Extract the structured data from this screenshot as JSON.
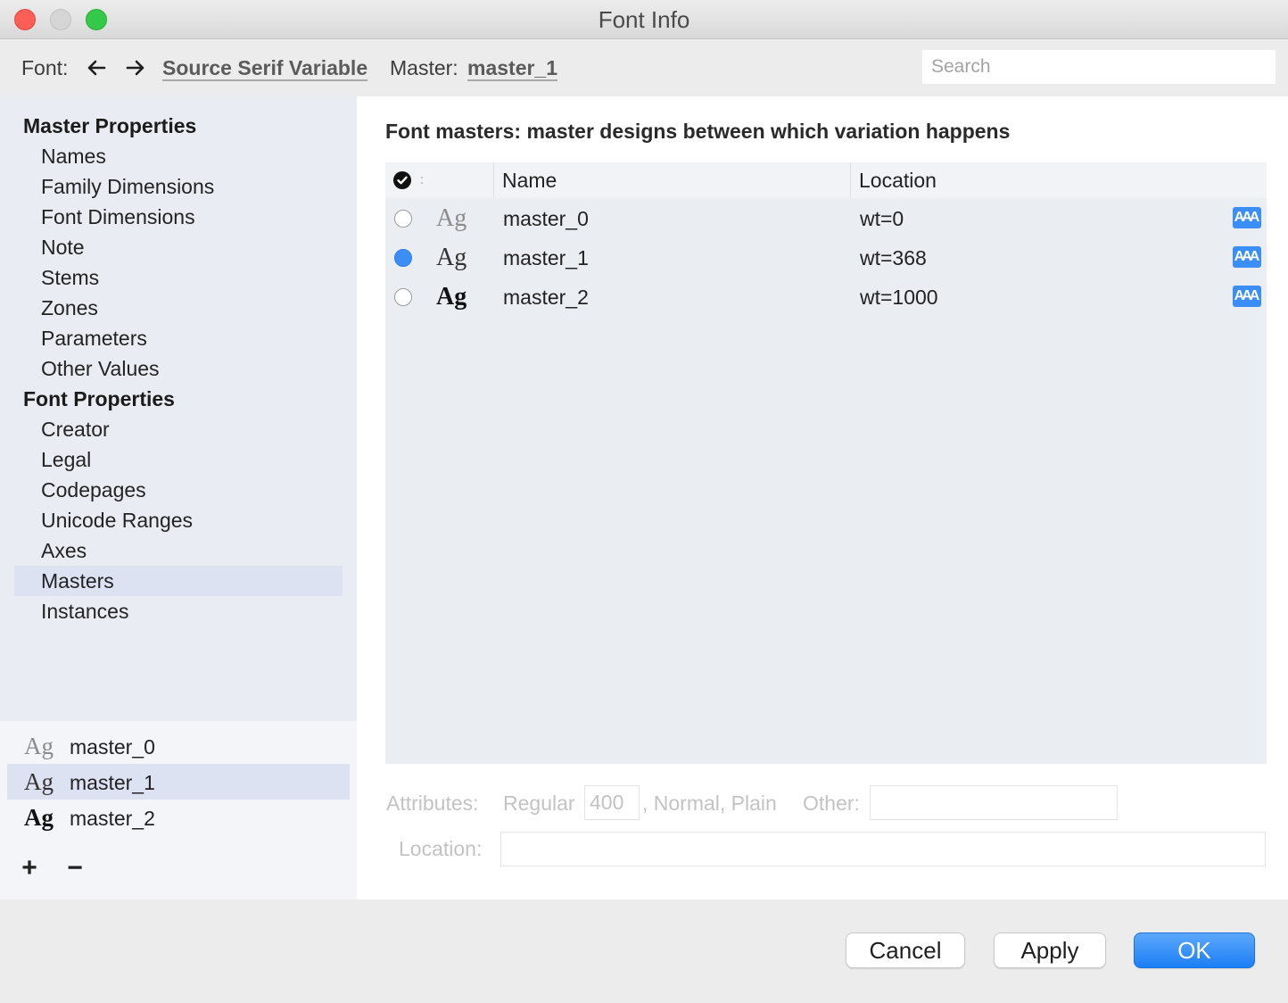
{
  "window": {
    "title": "Font Info",
    "icons": {
      "close": "close-icon",
      "minimize": "minimize-icon",
      "zoom": "zoom-icon"
    }
  },
  "toolbar": {
    "font_label": "Font:",
    "font_name": "Source Serif Variable",
    "master_label": "Master:",
    "master_name": "master_1",
    "search_placeholder": "Search",
    "icons": {
      "back": "arrow-left-icon",
      "forward": "arrow-right-icon"
    }
  },
  "sidebar": {
    "sections": [
      {
        "title": "Master Properties",
        "items": [
          {
            "label": "Names",
            "selected": false
          },
          {
            "label": "Family Dimensions",
            "selected": false
          },
          {
            "label": "Font Dimensions",
            "selected": false
          },
          {
            "label": "Note",
            "selected": false
          },
          {
            "label": "Stems",
            "selected": false
          },
          {
            "label": "Zones",
            "selected": false
          },
          {
            "label": "Parameters",
            "selected": false
          },
          {
            "label": "Other Values",
            "selected": false
          }
        ]
      },
      {
        "title": "Font Properties",
        "items": [
          {
            "label": "Creator",
            "selected": false
          },
          {
            "label": "Legal",
            "selected": false
          },
          {
            "label": "Codepages",
            "selected": false
          },
          {
            "label": "Unicode Ranges",
            "selected": false
          },
          {
            "label": "Axes",
            "selected": false
          },
          {
            "label": "Masters",
            "selected": true
          },
          {
            "label": "Instances",
            "selected": false
          }
        ]
      }
    ]
  },
  "master_list": {
    "items": [
      {
        "sample": "Ag",
        "name": "master_0",
        "selected": false
      },
      {
        "sample": "Ag",
        "name": "master_1",
        "selected": true
      },
      {
        "sample": "Ag",
        "name": "master_2",
        "selected": false
      }
    ],
    "add_label": "+",
    "remove_label": "−"
  },
  "main": {
    "heading": "Font masters: master designs between which variation happens",
    "table": {
      "header": {
        "icon": "check-circle-icon",
        "name": "Name",
        "location": "Location"
      },
      "rows": [
        {
          "sample": "Ag",
          "name": "master_0",
          "location": "wt=0",
          "active": false,
          "icon_text": "AAA"
        },
        {
          "sample": "Ag",
          "name": "master_1",
          "location": "wt=368",
          "active": true,
          "icon_text": "AAA"
        },
        {
          "sample": "Ag",
          "name": "master_2",
          "location": "wt=1000",
          "active": false,
          "icon_text": "AAA"
        }
      ]
    },
    "attributes": {
      "label": "Attributes:",
      "width_name": "Regular",
      "weight_value": "400",
      "rest": ", Normal, Plain",
      "other_label": "Other:"
    },
    "location": {
      "label": "Location:"
    }
  },
  "buttons": {
    "cancel": "Cancel",
    "apply": "Apply",
    "ok": "OK"
  },
  "colors": {
    "accent": "#3b8ef5",
    "sidebar_bg": "#e9edf3",
    "sidebar_lower_bg": "#f3f5f9",
    "selection_bg": "#dde2f3",
    "table_bg": "#eaeef3",
    "chrome_bg": "#ececec"
  }
}
